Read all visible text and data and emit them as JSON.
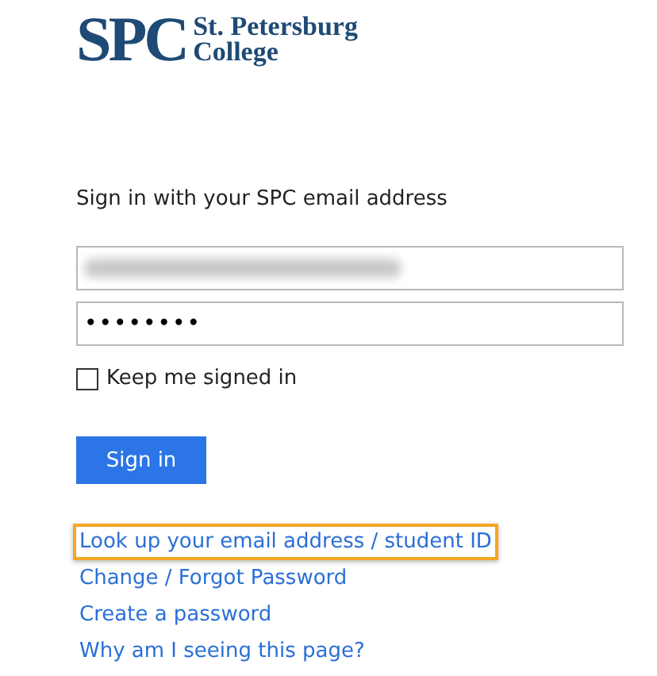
{
  "logo": {
    "initials": "SPC",
    "name_line_1": "St. Petersburg",
    "name_line_2": "College"
  },
  "prompt": "Sign in with your SPC email address",
  "email_field": {
    "redacted": true
  },
  "password_field": {
    "mask": "••••••••"
  },
  "keep_signed_in": {
    "label": "Keep me signed in",
    "checked": false
  },
  "sign_in_button": "Sign in",
  "links": [
    {
      "label": "Look up your email address / student ID",
      "highlighted": true
    },
    {
      "label": "Change / Forgot Password",
      "highlighted": false
    },
    {
      "label": "Create a password",
      "highlighted": false
    },
    {
      "label": "Why am I seeing this page?",
      "highlighted": false
    }
  ]
}
